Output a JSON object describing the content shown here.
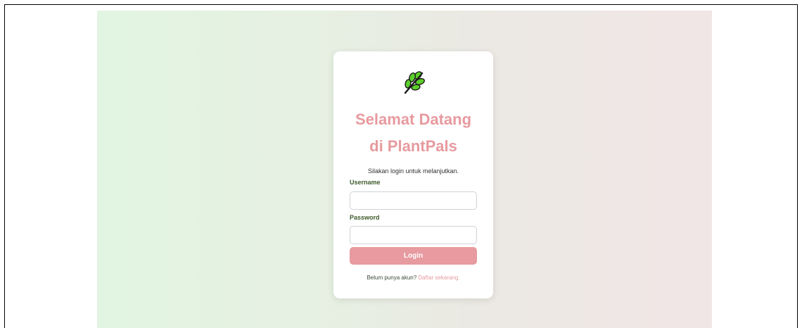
{
  "login": {
    "title_line1": "Selamat Datang",
    "title_line2": "di PlantPals",
    "subtitle": "Silakan login untuk melanjutkan.",
    "username_label": "Username",
    "username_value": "",
    "password_label": "Password",
    "password_value": "",
    "button_label": "Login",
    "register_prompt": "Belum punya akun?",
    "register_link": "Daftar sekarang."
  },
  "colors": {
    "accent": "#e79a9f",
    "label_green": "#3d5a2a",
    "leaf_green": "#5ccf2a"
  },
  "icons": {
    "logo": "leaf-icon"
  }
}
